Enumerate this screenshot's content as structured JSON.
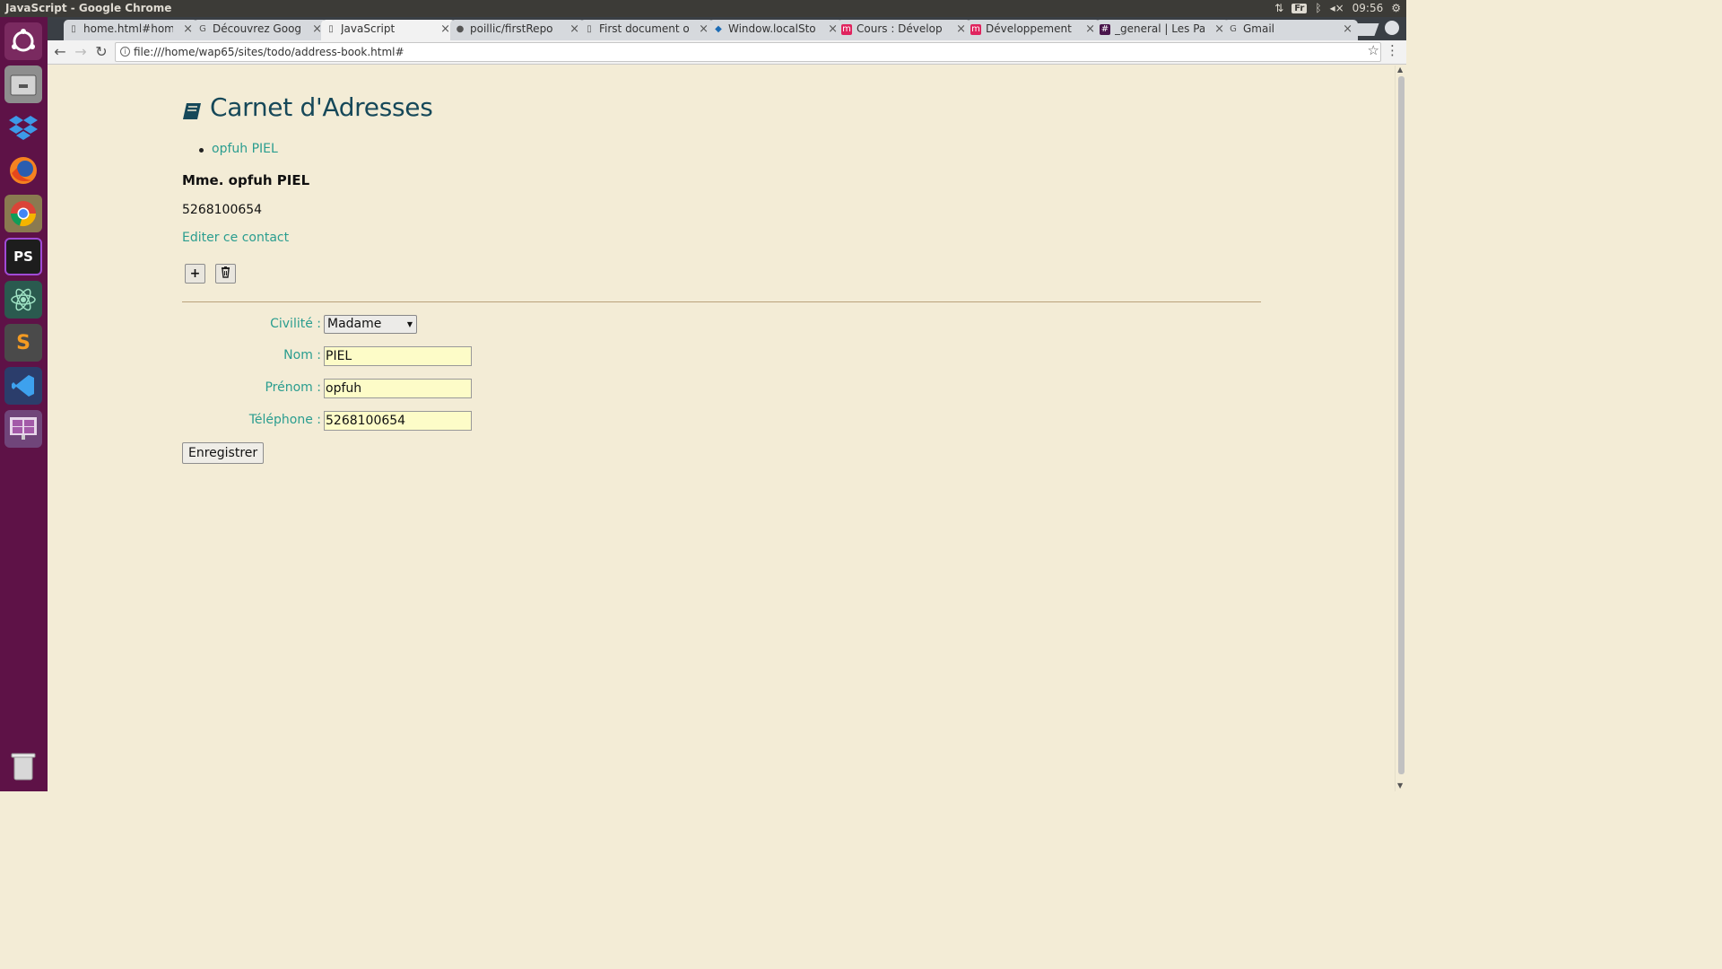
{
  "window_title": "JavaScript - Google Chrome",
  "system_tray": {
    "keyboard": "Fr",
    "time": "09:56"
  },
  "tabs": [
    {
      "label": "home.html#hom",
      "favicon": "page-icon"
    },
    {
      "label": "Découvrez Goog",
      "favicon": "google-icon"
    },
    {
      "label": "JavaScript",
      "favicon": "page-icon"
    },
    {
      "label": "poillic/firstRepo",
      "favicon": "github-icon"
    },
    {
      "label": "First document o",
      "favicon": "page-icon"
    },
    {
      "label": "Window.localSto",
      "favicon": "mdn-icon"
    },
    {
      "label": "Cours : Dévelop",
      "favicon": "openclassrooms-icon"
    },
    {
      "label": "Développement",
      "favicon": "openclassrooms-icon"
    },
    {
      "label": "_general | Les Pa",
      "favicon": "slack-icon"
    },
    {
      "label": "Gmail",
      "favicon": "google-icon"
    }
  ],
  "active_tab": 2,
  "address": "file:///home/wap65/sites/todo/address-book.html#",
  "page": {
    "title": "Carnet d'Adresses",
    "contacts": [
      "opfuh PIEL"
    ],
    "selected_fullname": "Mme. opfuh PIEL",
    "selected_phone": "5268100654",
    "edit_link": "Editer ce contact",
    "add_glyph": "+",
    "form": {
      "civility_label": "Civilité :",
      "civility_value": "Madame",
      "lastname_label": "Nom :",
      "lastname_value": "PIEL",
      "firstname_label": "Prénom :",
      "firstname_value": "opfuh",
      "phone_label": "Téléphone :",
      "phone_value": "5268100654",
      "save_label": "Enregistrer"
    }
  },
  "colors": {
    "accent": "#2a9d8f",
    "heading": "#164859",
    "page_bg": "#f3ecd6",
    "input_bg": "#fdfcc8"
  }
}
